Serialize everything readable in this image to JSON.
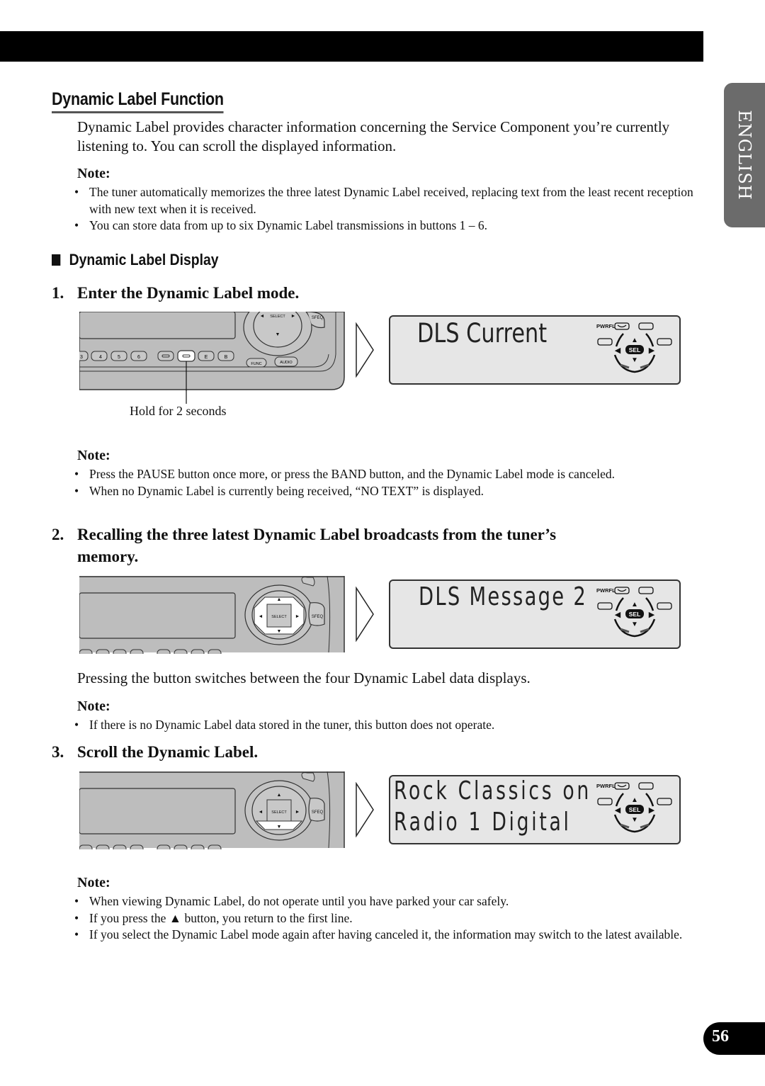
{
  "page": {
    "language_tab": "ENGLISH",
    "page_number": "56"
  },
  "section": {
    "title": "Dynamic Label Function",
    "intro": "Dynamic Label provides character information concerning the Service Component you’re currently listening to. You can scroll the displayed information.",
    "note1": {
      "title": "Note:",
      "items": [
        "The tuner automatically memorizes the three latest Dynamic Label received, replacing text from the least recent reception with new text when it is received.",
        "You can store data from up to six Dynamic Label transmissions in buttons 1 – 6."
      ]
    }
  },
  "subsection": {
    "title": "Dynamic Label Display"
  },
  "steps": [
    {
      "number": "1.",
      "title": "Enter the Dynamic Label mode.",
      "caption": "Hold for 2 seconds",
      "lcd_lines": [
        "DLS Current"
      ],
      "note": {
        "title": "Note:",
        "items": [
          "Press the PAUSE button once more, or press the BAND button, and the Dynamic Label mode is canceled.",
          "When no Dynamic Label is currently being received, “NO TEXT” is displayed."
        ]
      }
    },
    {
      "number": "2.",
      "title_line1": "Recalling the three latest Dynamic Label broadcasts from the tuner’s",
      "title_line2": "memory.",
      "lcd_lines": [
        "DLS Message 2"
      ],
      "body": "Pressing the button switches between the four Dynamic Label data displays.",
      "note": {
        "title": "Note:",
        "items": [
          "If there is no Dynamic Label data stored in the tuner, this button does not operate."
        ]
      }
    },
    {
      "number": "3.",
      "title": "Scroll the Dynamic Label.",
      "lcd_lines": [
        "Rock Classics on",
        "Radio 1 Digital"
      ],
      "note": {
        "title": "Note:",
        "items": [
          "When viewing Dynamic Label, do not operate until you have parked your car safely.",
          "If you press the ▲ button, you return to the first line.",
          "If you select the Dynamic Label mode again after having canceled it, the information may switch to the latest available."
        ]
      }
    }
  ],
  "device": {
    "select_label": "SELECT",
    "sfeq_label": "SFEQ",
    "func_label": "FUNC",
    "audio_label": "AUDIO",
    "preset_labels": [
      "3",
      "4",
      "5",
      "6"
    ],
    "e_label": "E",
    "b_label": "B"
  },
  "lcd_indicators": {
    "pwrfl_label": "PWRFL",
    "sel_label": "SEL"
  }
}
